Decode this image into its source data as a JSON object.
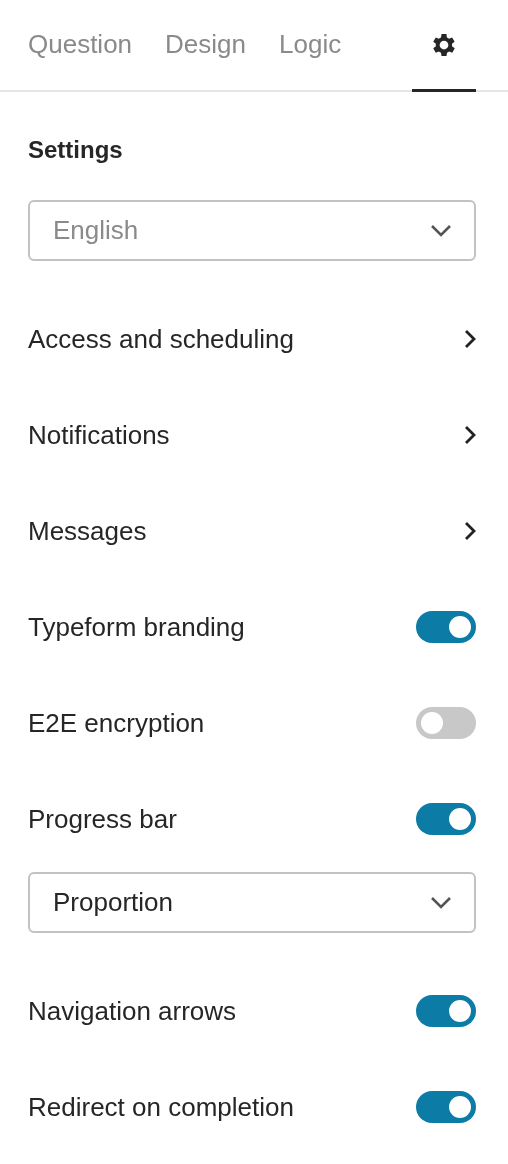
{
  "tabs": [
    {
      "kind": "text",
      "label": "Question",
      "selected": false
    },
    {
      "kind": "text",
      "label": "Design",
      "selected": false
    },
    {
      "kind": "text",
      "label": "Logic",
      "selected": false
    },
    {
      "kind": "gear",
      "selected": true
    }
  ],
  "settings": {
    "title": "Settings",
    "language": {
      "value": "English",
      "placeholder_style": true
    },
    "items": [
      {
        "kind": "link",
        "label": "Access and scheduling"
      },
      {
        "kind": "link",
        "label": "Notifications"
      },
      {
        "kind": "link",
        "label": "Messages"
      },
      {
        "kind": "toggle",
        "label": "Typeform branding",
        "on": true
      },
      {
        "kind": "toggle",
        "label": "E2E encryption",
        "on": false
      },
      {
        "kind": "toggle",
        "label": "Progress bar",
        "on": true
      },
      {
        "kind": "select",
        "value": "Proportion"
      },
      {
        "kind": "toggle",
        "label": "Navigation arrows",
        "on": true
      },
      {
        "kind": "toggle",
        "label": "Redirect on completion",
        "on": true
      }
    ]
  }
}
